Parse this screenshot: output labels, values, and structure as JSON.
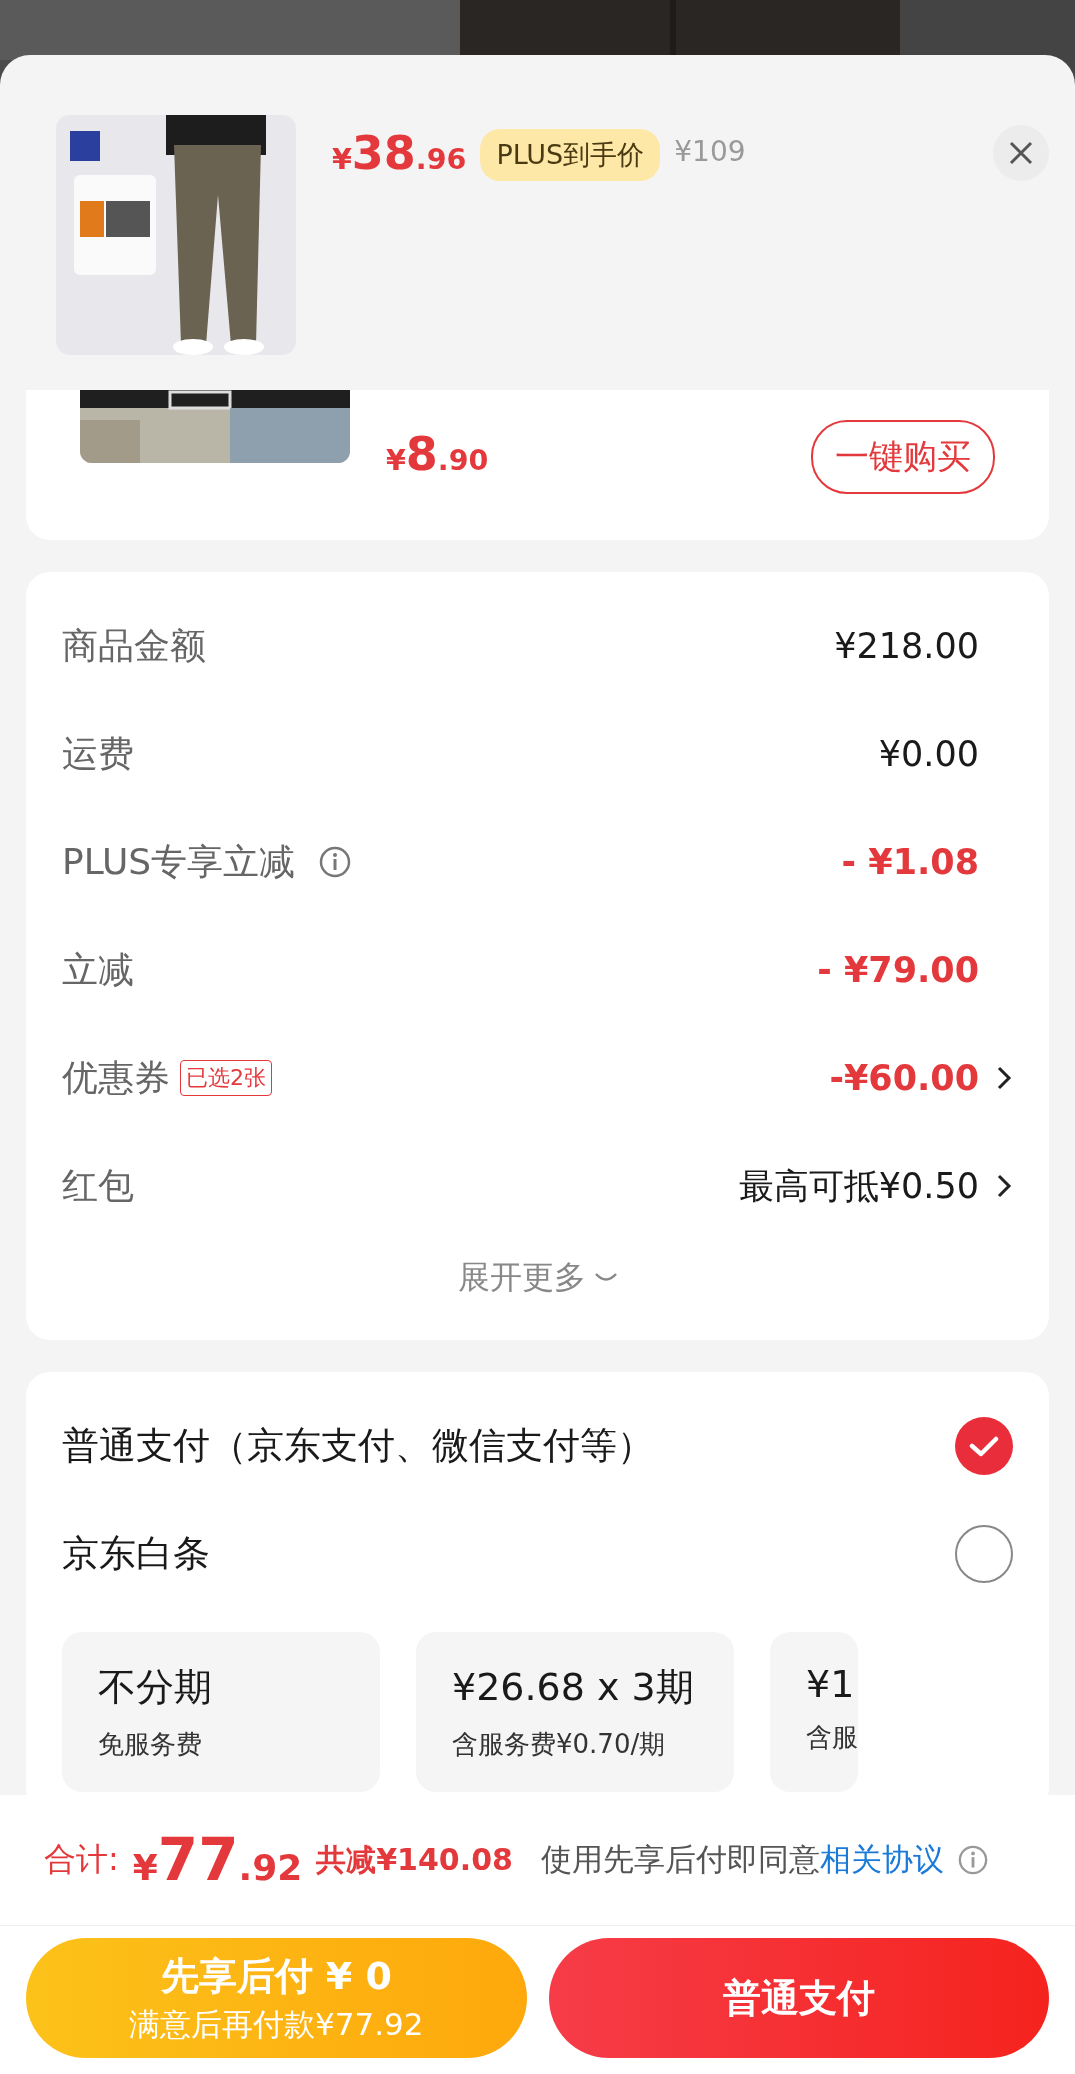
{
  "header": {
    "price": {
      "currency": "¥",
      "integer": "38",
      "decimals": ".96"
    },
    "badge": "PLUS到手价",
    "original_price": "¥109"
  },
  "recommended_item": {
    "price": {
      "currency": "¥",
      "integer": "8",
      "decimals": ".90"
    },
    "button": "一键购买"
  },
  "summary": {
    "rows": [
      {
        "label": "商品金额",
        "value": "¥218.00",
        "discount": false,
        "info": false,
        "chevron": false
      },
      {
        "label": "运费",
        "value": "¥0.00",
        "discount": false,
        "info": false,
        "chevron": false
      },
      {
        "label": "PLUS专享立减",
        "value": "- ¥1.08",
        "discount": true,
        "info": true,
        "chevron": false
      },
      {
        "label": "立减",
        "value": "- ¥79.00",
        "discount": true,
        "info": false,
        "chevron": false
      },
      {
        "label": "优惠券",
        "badge": "已选2张",
        "value": "-¥60.00",
        "discount": true,
        "info": false,
        "chevron": true
      },
      {
        "label": "红包",
        "value": "最高可抵¥0.50",
        "discount": false,
        "info": false,
        "chevron": true
      }
    ],
    "expand": "展开更多"
  },
  "payment": {
    "options": [
      {
        "label": "普通支付（京东支付、微信支付等）",
        "selected": true
      },
      {
        "label": "京东白条",
        "selected": false
      }
    ],
    "installments": [
      {
        "title": "不分期",
        "subtitle": "免服务费"
      },
      {
        "title": "¥26.68 x 3期",
        "subtitle": "含服务费¥0.70/期"
      },
      {
        "title": "¥1",
        "subtitle": "含服"
      }
    ]
  },
  "footer": {
    "total": {
      "label": "合计:",
      "currency": "¥",
      "integer": "77",
      "decimals": ".92",
      "saving": "共减¥140.08"
    },
    "agreement": {
      "text": "使用先享后付即同意",
      "link": "相关协议"
    },
    "buttons": [
      {
        "title": "先享后付 ¥ 0",
        "subtitle": "满意后再付款¥77.92"
      },
      {
        "title": "普通支付"
      }
    ]
  }
}
